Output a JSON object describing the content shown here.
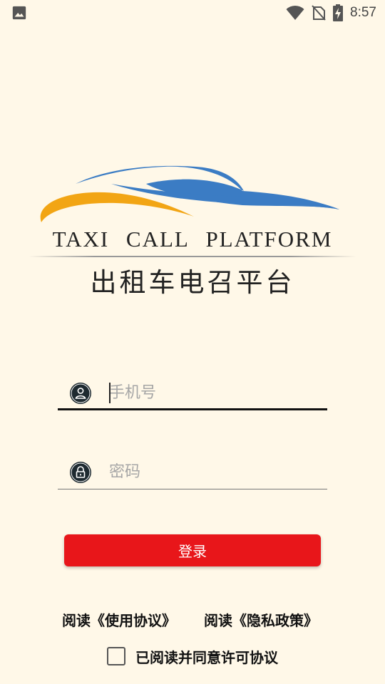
{
  "status_bar": {
    "time": "8:57",
    "icons": [
      "image-icon",
      "wifi-icon",
      "no-sim-icon",
      "battery-charging-icon"
    ]
  },
  "logo": {
    "text_en": "TAXI CALL PLATFORM",
    "text_cn": "出租车电召平台",
    "colors": {
      "blue": "#3B7CC4",
      "orange": "#F2A514"
    }
  },
  "form": {
    "phone": {
      "placeholder": "手机号",
      "value": "",
      "icon": "user-icon"
    },
    "password": {
      "placeholder": "密码",
      "value": "",
      "icon": "lock-icon"
    },
    "login_label": "登录"
  },
  "links": {
    "terms": "阅读《使用协议》",
    "privacy": "阅读《隐私政策》"
  },
  "agreement": {
    "label": "已阅读并同意许可协议",
    "checked": false
  },
  "colors": {
    "background": "#FFF8E8",
    "accent": "#E8161A"
  }
}
